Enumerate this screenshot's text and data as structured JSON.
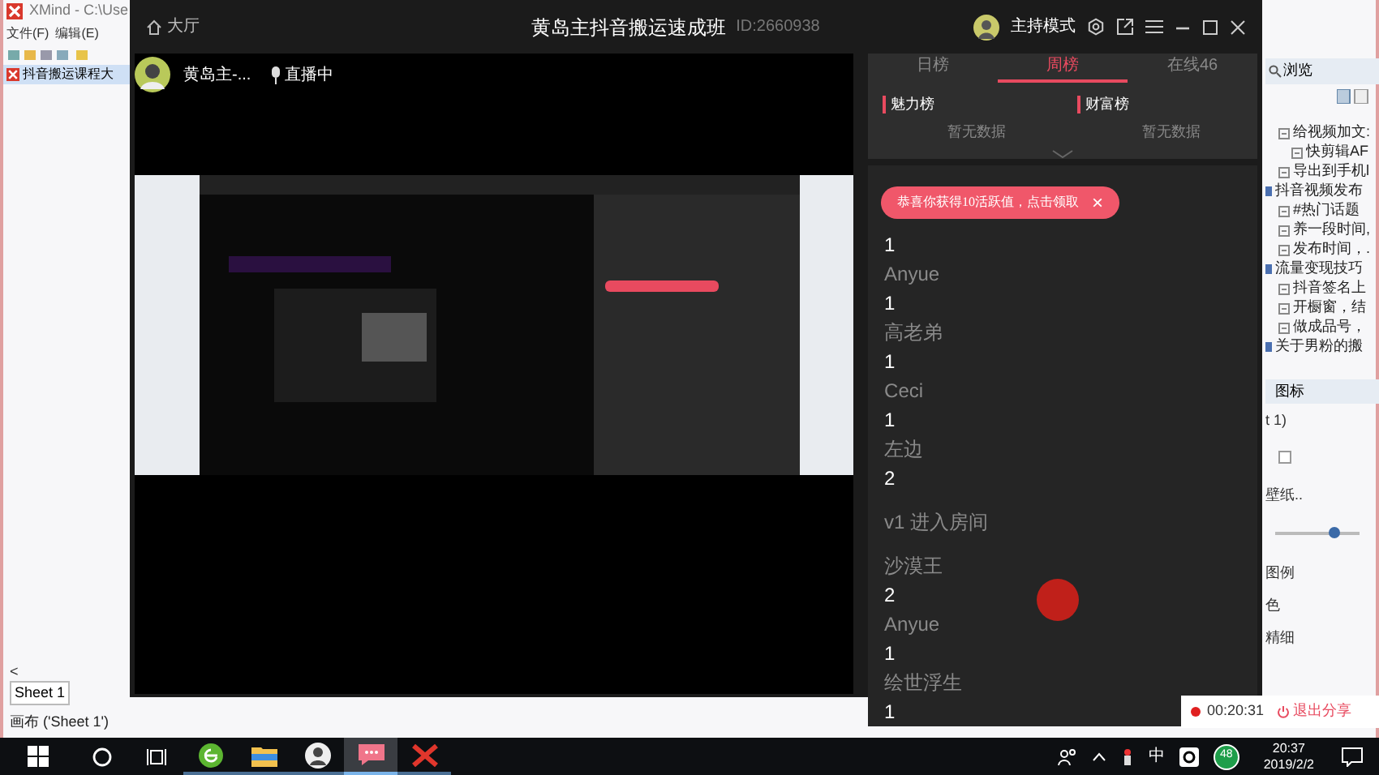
{
  "xmind": {
    "title": "XMind - C:\\Use",
    "menu": [
      "文件(F)",
      "编辑(E)"
    ],
    "tab": "抖音搬运课程大",
    "scroll_arrow": "<",
    "sheet_tab": "Sheet 1",
    "status": "画布 ('Sheet 1')",
    "outline_panel": {
      "title": "浏览",
      "items": [
        {
          "text": "给视频加文:",
          "kind": "topic",
          "children": [
            {
              "text": "快剪辑AF",
              "kind": "topic"
            }
          ]
        },
        {
          "text": "导出到手机l",
          "kind": "topic"
        },
        {
          "text": "抖音视频发布",
          "kind": "branch",
          "children": [
            {
              "text": "#热门话题",
              "kind": "topic"
            },
            {
              "text": "养一段时间,",
              "kind": "topic"
            },
            {
              "text": "发布时间，.",
              "kind": "topic"
            }
          ]
        },
        {
          "text": "流量变现技巧",
          "kind": "branch",
          "children": [
            {
              "text": "抖音签名上",
              "kind": "topic"
            },
            {
              "text": "开橱窗，结",
              "kind": "topic"
            },
            {
              "text": "做成品号，",
              "kind": "topic"
            }
          ]
        },
        {
          "text": "关于男粉的搬",
          "kind": "branch"
        }
      ]
    },
    "icons_panel": {
      "title": "图标",
      "rows": [
        {
          "kind": "text",
          "text": "t 1)"
        },
        {
          "kind": "checkbox",
          "checked": false
        },
        {
          "kind": "text",
          "text": "壁纸.."
        },
        {
          "kind": "slider",
          "level": 0.7
        },
        {
          "kind": "text",
          "text": "图例"
        },
        {
          "kind": "text",
          "text": "色"
        },
        {
          "kind": "text",
          "text": "精细"
        }
      ]
    }
  },
  "live_window": {
    "lobby": "大厅",
    "title": "黄岛主抖音搬运速成班",
    "room_id": "ID:2660938",
    "mode": "主持模式",
    "host": {
      "name": "黄岛主-...",
      "status": "直播中"
    },
    "tabs": [
      {
        "label": "日榜",
        "selected": false
      },
      {
        "label": "周榜",
        "selected": true
      },
      {
        "label": "在线46",
        "selected": false
      }
    ],
    "boards": [
      {
        "title": "魅力榜",
        "empty": "暂无数据"
      },
      {
        "title": "财富榜",
        "empty": "暂无数据"
      }
    ],
    "toast": {
      "text": "恭喜你获得10活跃值，点击领取",
      "close": "×"
    },
    "chat": [
      {
        "kind": "user",
        "count": "1"
      },
      {
        "kind": "user",
        "name": "Anyue",
        "count": "1"
      },
      {
        "kind": "user",
        "name": "高老弟",
        "count": "1"
      },
      {
        "kind": "user",
        "name": "Ceci",
        "count": "1"
      },
      {
        "kind": "user",
        "name": "左边",
        "count": "2"
      },
      {
        "kind": "system",
        "text": "v1 进入房间"
      },
      {
        "kind": "user",
        "name": "沙漠王",
        "count": "2"
      },
      {
        "kind": "user",
        "name": "Anyue",
        "count": "1"
      },
      {
        "kind": "user",
        "name": "绘世浮生",
        "count": "1"
      }
    ]
  },
  "share_bar": {
    "time": "00:20:31",
    "exit": "退出分享"
  },
  "taskbar": {
    "apps": [
      {
        "kind": "browser",
        "selected": false
      },
      {
        "kind": "folder",
        "selected": false
      },
      {
        "kind": "avatar",
        "selected": false
      },
      {
        "kind": "chat",
        "selected": true
      },
      {
        "kind": "xmind",
        "selected": false
      }
    ],
    "language": "中",
    "badge": "48",
    "time": "20:37",
    "date": "2019/2/2"
  }
}
